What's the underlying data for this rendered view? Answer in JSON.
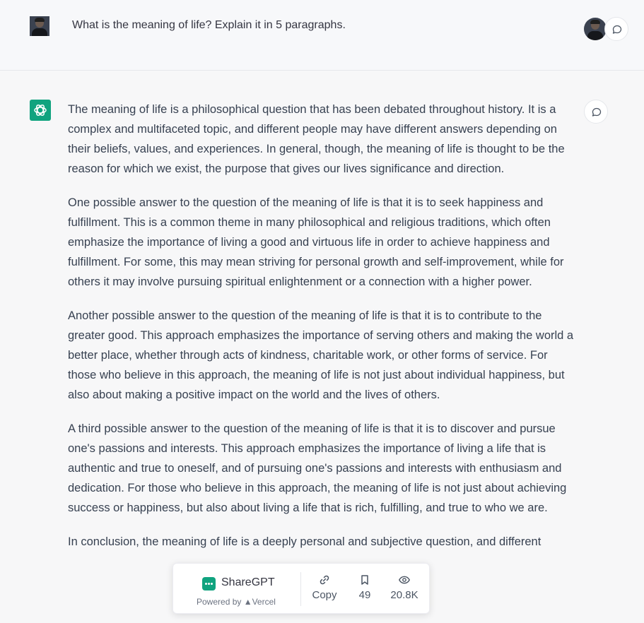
{
  "user": {
    "question": "What is the meaning of life? Explain it in 5 paragraphs."
  },
  "icons": {
    "user_avatar": "user-avatar-photo",
    "feedback": "speech-bubble-icon",
    "assistant": "openai-logo-icon"
  },
  "response": {
    "paragraphs": [
      "The meaning of life is a philosophical question that has been debated throughout history. It is a complex and multifaceted topic, and different people may have different answers depending on their beliefs, values, and experiences. In general, though, the meaning of life is thought to be the reason for which we exist, the purpose that gives our lives significance and direction.",
      "One possible answer to the question of the meaning of life is that it is to seek happiness and fulfillment. This is a common theme in many philosophical and religious traditions, which often emphasize the importance of living a good and virtuous life in order to achieve happiness and fulfillment. For some, this may mean striving for personal growth and self-improvement, while for others it may involve pursuing spiritual enlightenment or a connection with a higher power.",
      "Another possible answer to the question of the meaning of life is that it is to contribute to the greater good. This approach emphasizes the importance of serving others and making the world a better place, whether through acts of kindness, charitable work, or other forms of service. For those who believe in this approach, the meaning of life is not just about individual happiness, but also about making a positive impact on the world and the lives of others.",
      "A third possible answer to the question of the meaning of life is that it is to discover and pursue one's passions and interests. This approach emphasizes the importance of living a life that is authentic and true to oneself, and of pursuing one's passions and interests with enthusiasm and dedication. For those who believe in this approach, the meaning of life is not just about achieving success or happiness, but also about living a life that is rich, fulfilling, and true to who we are.",
      "In conclusion, the meaning of life is a deeply personal and subjective question, and different"
    ]
  },
  "sharebar": {
    "brand": "ShareGPT",
    "powered_by": "Powered by ▲Vercel",
    "copy_label": "Copy",
    "bookmark_count": "49",
    "view_count": "20.8K"
  },
  "colors": {
    "accent": "#10a37f",
    "text": "#374151",
    "background": "#f7f7f8"
  }
}
